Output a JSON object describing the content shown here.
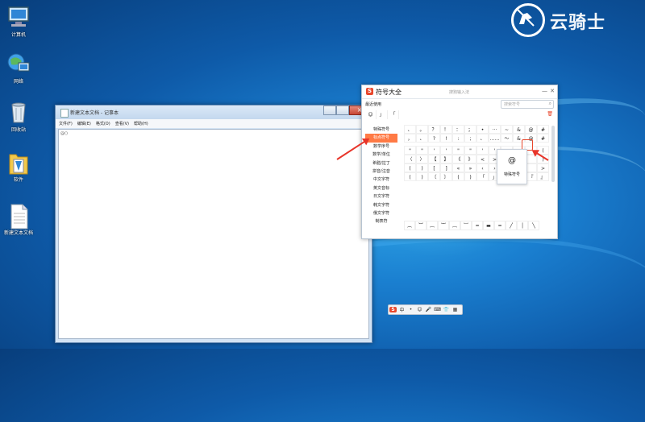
{
  "desktop": {
    "icons": [
      {
        "label": "计算机",
        "icon": "computer-icon"
      },
      {
        "label": "网络",
        "icon": "network-icon"
      },
      {
        "label": "回收站",
        "icon": "recycle-bin-icon"
      },
      {
        "label": "软件",
        "icon": "folder-icon"
      },
      {
        "label": "新建文本文档",
        "icon": "text-document-icon"
      }
    ],
    "watermark": "云骑士"
  },
  "notepad": {
    "title": "新建文本文档 - 记事本",
    "menu": [
      "文件(F)",
      "编辑(E)",
      "格式(O)",
      "查看(V)",
      "帮助(H)"
    ],
    "content": "@()"
  },
  "symbol_panel": {
    "title": "符号大全",
    "subtitle": "搜狗输入法",
    "recent_label": "最近使用",
    "recent": [
      "☺",
      "」",
      "「"
    ],
    "search_placeholder": "搜索符号",
    "categories": [
      "特殊符号",
      "标点符号",
      "数学序号",
      "数学/单位",
      "希腊/拉丁",
      "拼音/注音",
      "中文字符",
      "英文音标",
      "日文字符",
      "韩文字符",
      "俄文字符",
      "制表符"
    ],
    "selected_category": "标点符号",
    "grid_rows": [
      [
        "、",
        "。",
        "？",
        "！",
        "：",
        "；",
        "•",
        "···",
        "~",
        "&",
        "@",
        "#"
      ],
      [
        "，",
        "、",
        "?",
        "!",
        ":",
        ";",
        "、",
        "……",
        "～",
        "&",
        "@",
        "#"
      ],
      [
        "\"",
        "\"",
        "'",
        "'",
        "\"",
        "\"",
        "'",
        "'",
        "",
        "",
        "",
        "("
      ],
      [
        "〈",
        "〉",
        "【",
        "】",
        "《",
        "》",
        "<",
        ">",
        "",
        "",
        "",
        ")"
      ],
      [
        "(",
        ")",
        "[",
        "]",
        "«",
        "»",
        "‹",
        "›",
        "(",
        ")",
        "",
        ">"
      ],
      [
        "(",
        ")",
        "〔",
        "〕",
        "(",
        ")",
        "「",
        "」",
        "〖",
        "〗",
        "『",
        "』"
      ]
    ],
    "line_symbols": [
      "︵",
      "︶",
      "︷",
      "︸",
      "︹",
      "︺",
      "━",
      "▬",
      "═",
      "╱",
      "│",
      "╲"
    ],
    "preview": {
      "char": "@",
      "name": "特殊符号"
    }
  },
  "ime_toolbar": [
    "S",
    "中",
    "•",
    "☺",
    "🎤",
    "⌨",
    "👕",
    "▦"
  ],
  "colors": {
    "accent": "#ff7a45",
    "arrow": "#e8352a"
  }
}
